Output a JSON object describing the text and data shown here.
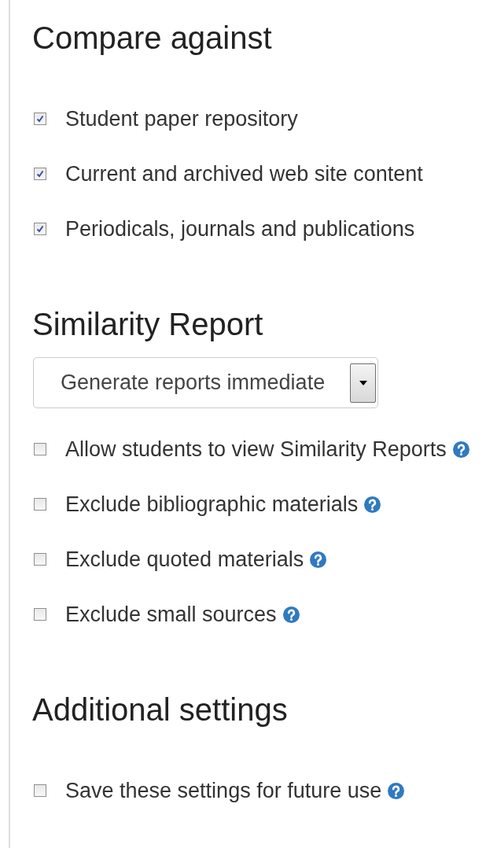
{
  "sections": [
    {
      "title": "Compare against",
      "items": [
        {
          "kind": "checkbox",
          "label": "Student paper repository",
          "checked": true,
          "help": false
        },
        {
          "kind": "checkbox",
          "label": "Current and archived web site content",
          "checked": true,
          "help": false
        },
        {
          "kind": "checkbox",
          "label": "Periodicals, journals and publications",
          "checked": true,
          "help": false
        }
      ]
    },
    {
      "title": "Similarity Report",
      "items": [
        {
          "kind": "select",
          "value": "Generate reports immediate"
        },
        {
          "kind": "checkbox",
          "label": "Allow students to view Similarity Reports",
          "checked": false,
          "help": true
        },
        {
          "kind": "checkbox",
          "label": "Exclude bibliographic materials",
          "checked": false,
          "help": true
        },
        {
          "kind": "checkbox",
          "label": "Exclude quoted materials",
          "checked": false,
          "help": true
        },
        {
          "kind": "checkbox",
          "label": "Exclude small sources",
          "checked": false,
          "help": true
        }
      ]
    },
    {
      "title": "Additional settings",
      "items": [
        {
          "kind": "checkbox",
          "label": "Save these settings for future use",
          "checked": false,
          "help": true
        }
      ]
    }
  ]
}
